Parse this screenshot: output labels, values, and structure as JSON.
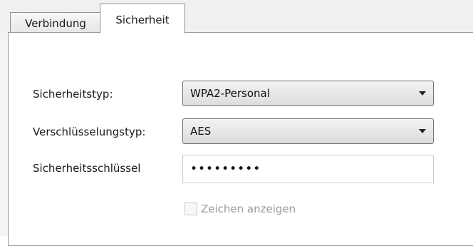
{
  "tabs": [
    {
      "label": "Verbindung",
      "active": false
    },
    {
      "label": "Sicherheit",
      "active": true
    }
  ],
  "form": {
    "security_type_label": "Sicherheitstyp:",
    "security_type_value": "WPA2-Personal",
    "encryption_type_label": "Verschlüsselungstyp:",
    "encryption_type_value": "AES",
    "security_key_label": "Sicherheitsschlüssel",
    "security_key_value": "•••••••••",
    "show_characters_label": "Zeichen anzeigen",
    "show_characters_checked": false,
    "show_characters_enabled": false
  },
  "icons": {
    "dropdown_arrow": "chevron-down-icon",
    "checkbox": "checkbox-unchecked-icon"
  },
  "colors": {
    "panel_background": "#ffffff",
    "disabled_text": "#9a9a9a",
    "border": "#9a9a9a"
  }
}
